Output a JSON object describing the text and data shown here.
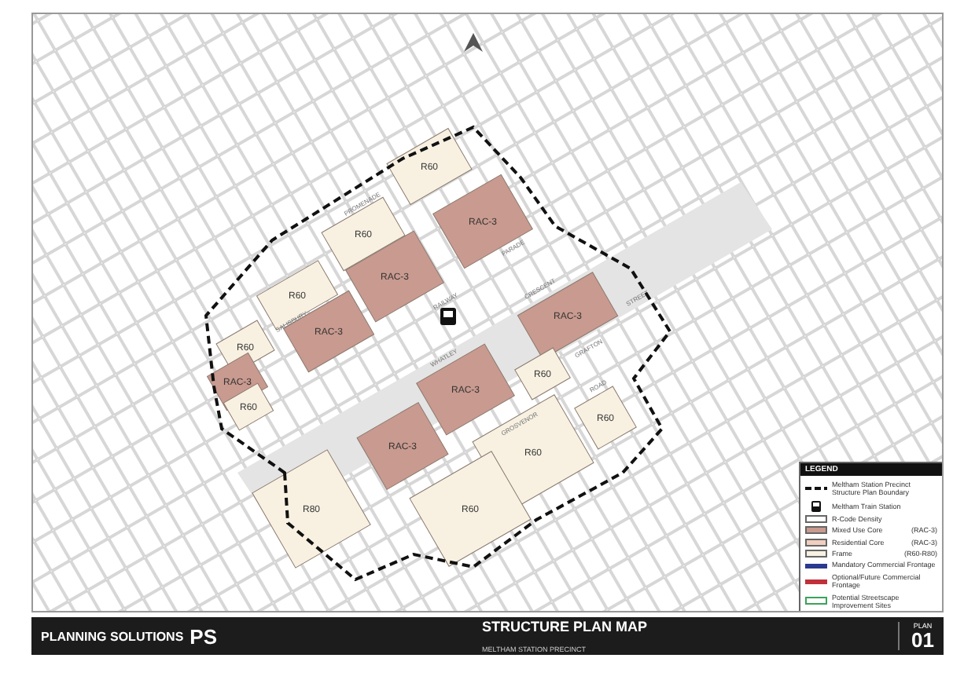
{
  "map": {
    "streets": [
      "RAILWAY",
      "PARADE",
      "CRESCENT",
      "WHATLEY",
      "GRAFTON",
      "ROAD",
      "GROSVENOR",
      "STREET",
      "PROMENADE",
      "SALISBURY"
    ],
    "zones": [
      {
        "kind": "frame",
        "label": "R60"
      },
      {
        "kind": "core",
        "label": "RAC-3"
      },
      {
        "kind": "frame",
        "label": "R60"
      },
      {
        "kind": "core",
        "label": "RAC-3"
      },
      {
        "kind": "frame",
        "label": "R60"
      },
      {
        "kind": "core",
        "label": "RAC-3"
      },
      {
        "kind": "frame",
        "label": "R60"
      },
      {
        "kind": "core",
        "label": "RAC-3"
      },
      {
        "kind": "frame",
        "label": "R60"
      },
      {
        "kind": "core",
        "label": "RAC-3"
      },
      {
        "kind": "frame",
        "label": "R60"
      },
      {
        "kind": "core",
        "label": "RAC-3"
      },
      {
        "kind": "frame",
        "label": "R60"
      },
      {
        "kind": "core",
        "label": "RAC-3"
      },
      {
        "kind": "frame",
        "label": "R60"
      },
      {
        "kind": "frame",
        "label": "R80"
      },
      {
        "kind": "frame",
        "label": "R60"
      }
    ]
  },
  "legend": {
    "title": "LEGEND",
    "items": [
      {
        "kind": "boundary",
        "label": "Meltham Station Precinct Structure Plan Boundary"
      },
      {
        "kind": "station",
        "label": "Meltham Train Station"
      },
      {
        "kind": "rcode",
        "label": "R-Code Density"
      },
      {
        "kind": "swatch",
        "color": "#c99a8f",
        "label": "Mixed Use Core",
        "code": "(RAC-3)"
      },
      {
        "kind": "swatch",
        "color": "#f0cfc0",
        "label": "Residential Core",
        "code": "(RAC-3)"
      },
      {
        "kind": "swatch",
        "color": "#f8f1e2",
        "label": "Frame",
        "code": "(R60-R80)"
      },
      {
        "kind": "line",
        "color": "#2b3a8f",
        "label": "Mandatory Commercial Frontage"
      },
      {
        "kind": "line",
        "color": "#c0303a",
        "label": "Optional/Future Commercial Frontage"
      },
      {
        "kind": "outline",
        "color": "#3aa35a",
        "label": "Potential Streetscape Improvement Sites"
      }
    ]
  },
  "title_block": {
    "company": "PLANNING SOLUTIONS",
    "monogram": "PS",
    "title": "STRUCTURE PLAN MAP",
    "subtitle": "MELTHAM STATION PRECINCT",
    "plan_label": "PLAN",
    "plan_number": "01"
  }
}
